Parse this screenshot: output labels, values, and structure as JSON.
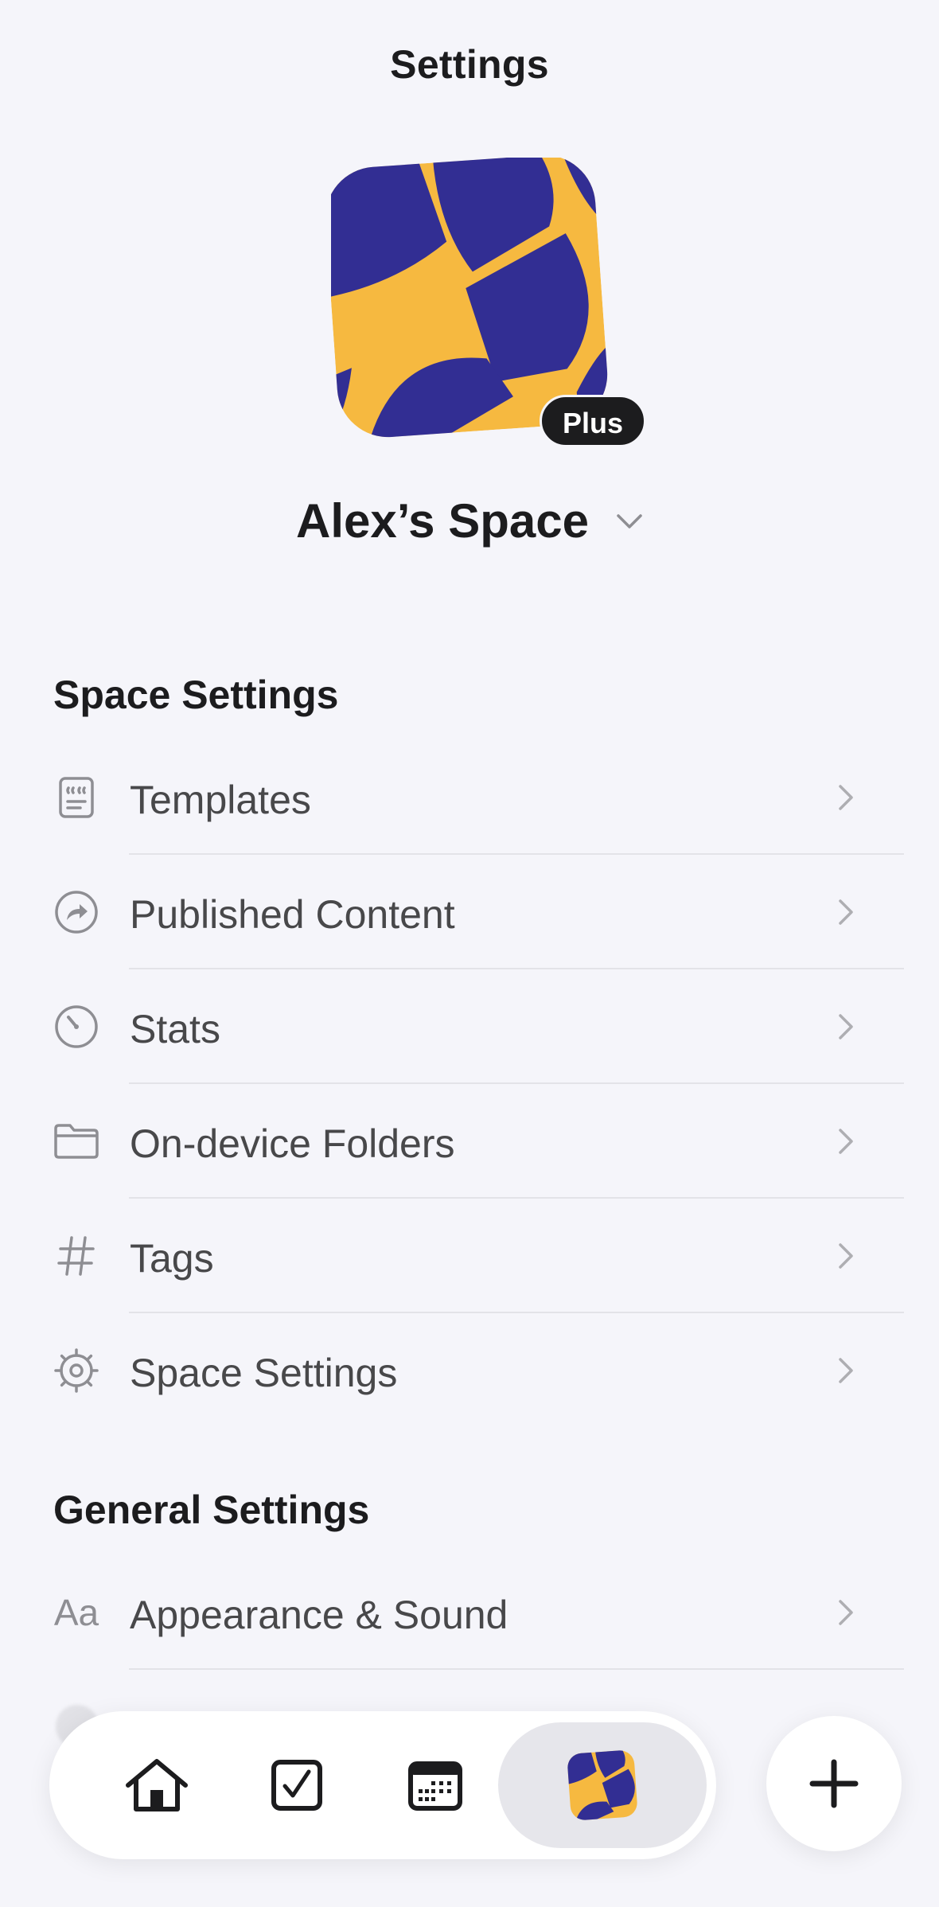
{
  "header": {
    "title": "Settings"
  },
  "space": {
    "name": "Alex’s Space",
    "plan_badge": "Plus",
    "avatar_colors": {
      "blue": "#322e93",
      "yellow": "#f6b940"
    }
  },
  "space_settings": {
    "header": "Space Settings",
    "items": [
      {
        "label": "Templates",
        "icon": "template-icon"
      },
      {
        "label": "Published Content",
        "icon": "share-arrow-icon"
      },
      {
        "label": "Stats",
        "icon": "gauge-icon"
      },
      {
        "label": "On-device Folders",
        "icon": "folder-icon"
      },
      {
        "label": "Tags",
        "icon": "hash-icon"
      },
      {
        "label": "Space Settings",
        "icon": "gear-icon"
      }
    ]
  },
  "general_settings": {
    "header": "General Settings",
    "items": [
      {
        "label": "Appearance & Sound",
        "icon_text": "Aa",
        "icon": "text-size-icon"
      }
    ]
  },
  "tab_bar": {
    "tabs": [
      {
        "name": "home",
        "icon": "home-icon"
      },
      {
        "name": "tasks",
        "icon": "checkbox-icon"
      },
      {
        "name": "calendar",
        "icon": "calendar-icon"
      },
      {
        "name": "space",
        "icon": "space-avatar-icon",
        "active": true
      }
    ],
    "fab_icon": "plus-icon"
  },
  "colors": {
    "background": "#f5f5fa",
    "text_primary": "#1c1c1e",
    "text_secondary": "#48484a",
    "icon_gray": "#8e8e93",
    "divider": "#e3e3e8"
  }
}
